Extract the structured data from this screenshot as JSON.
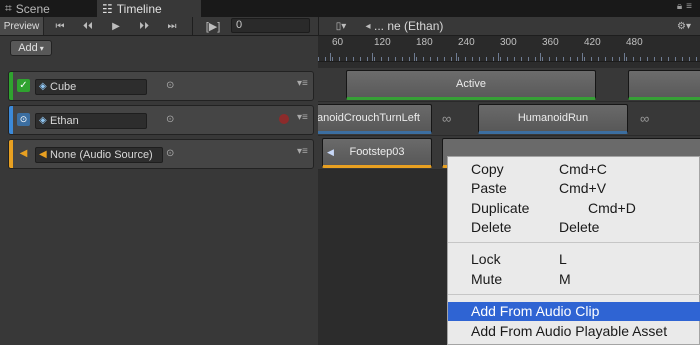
{
  "tabs": [
    {
      "label": "Scene",
      "icon": "grid-icon"
    },
    {
      "label": "Timeline",
      "icon": "timeline-icon"
    }
  ],
  "window_controls": {
    "lock": "lock-icon",
    "menu": "menu-icon"
  },
  "toolbar": {
    "preview_label": "Preview",
    "frame_mode_label": "[▶]",
    "frame_value": "0",
    "buttons": [
      "goto-start-icon",
      "prev-frame-icon",
      "play-icon",
      "next-frame-icon",
      "goto-end-icon"
    ]
  },
  "breadcrumb": {
    "text": "... ne (Ethan)"
  },
  "add_button": {
    "label": "Add"
  },
  "ruler": {
    "labels": [
      "60",
      "120",
      "180",
      "240",
      "300",
      "360",
      "420",
      "480"
    ]
  },
  "tracks": [
    {
      "name": "Cube",
      "color": "#2fa32f",
      "type": "activation",
      "toggle": "✓"
    },
    {
      "name": "Ethan",
      "color": "#3c8ad9",
      "type": "animation",
      "toggle": "⊙"
    },
    {
      "name": "None (Audio Source)",
      "color": "#e8a021",
      "type": "audio",
      "toggle": "◀"
    }
  ],
  "clips": {
    "active": "Active",
    "anim1": "anoidCrouchTurnLeft",
    "anim2": "HumanoidRun",
    "audio1": "Footstep03"
  },
  "menu": {
    "items": [
      {
        "label": "Copy",
        "shortcut": "Cmd+C"
      },
      {
        "label": "Paste",
        "shortcut": "Cmd+V"
      },
      {
        "label": "Duplicate",
        "shortcut": "Cmd+D"
      },
      {
        "label": "Delete",
        "shortcut": "Delete"
      },
      {
        "label": "Lock",
        "shortcut": "L"
      },
      {
        "label": "Mute",
        "shortcut": "M"
      },
      {
        "label": "Add From Audio Clip",
        "shortcut": ""
      },
      {
        "label": "Add From Audio Playable Asset",
        "shortcut": ""
      }
    ],
    "highlighted": "Add From Audio Clip"
  }
}
